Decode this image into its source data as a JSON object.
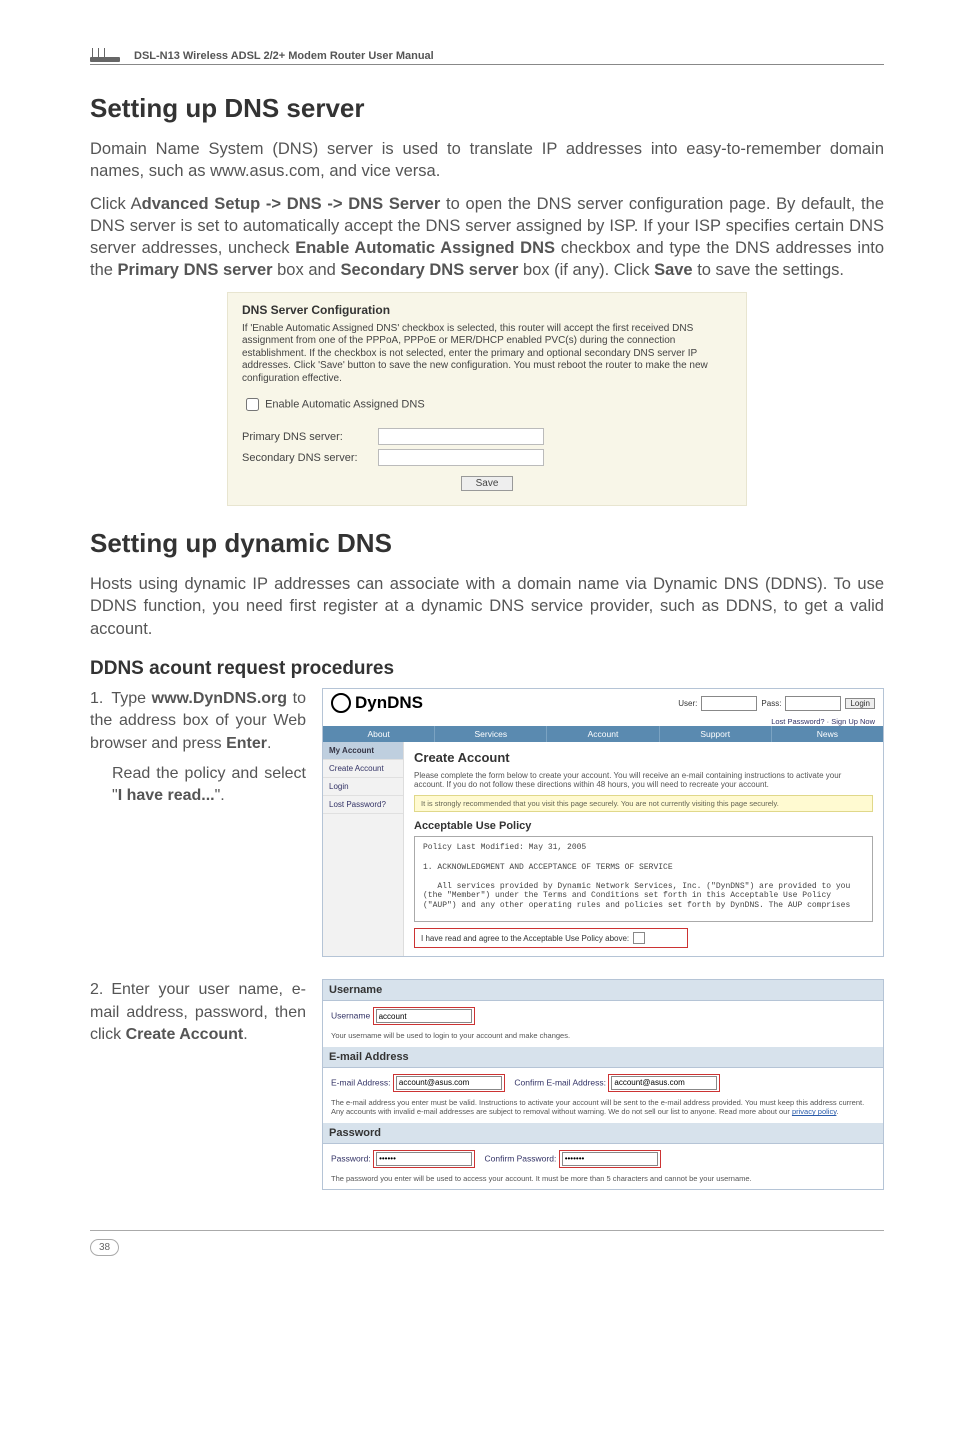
{
  "header": {
    "device_title": "DSL-N13 Wireless ADSL 2/2+ Modem Router User Manual"
  },
  "section1": {
    "title": "Setting up DNS server",
    "p1": "Domain Name System (DNS) server is used to translate IP addresses into easy-to-remember domain names, such as www.asus.com, and vice versa.",
    "p2_pre": "Click A",
    "p2_b1": "dvanced Setup -> DNS -> DNS Server",
    "p2_mid": " to open the DNS server configuration page. By default, the DNS server is set to automatically accept the DNS server assigned by ISP. If your ISP specifies certain DNS server addresses, uncheck ",
    "p2_b2": "Enable Automatic Assigned DNS",
    "p2_mid2": " checkbox and type the DNS addresses into the ",
    "p2_b3": "Primary DNS server",
    "p2_mid3": " box and ",
    "p2_b4": "Secondary DNS server",
    "p2_mid4": " box (if any). Click ",
    "p2_b5": "Save",
    "p2_end": " to save the settings."
  },
  "dnsbox": {
    "title": "DNS Server Configuration",
    "desc": "If 'Enable Automatic Assigned DNS' checkbox is selected, this router will accept the first received DNS assignment from one of the PPPoA, PPPoE or MER/DHCP enabled PVC(s) during the connection establishment. If the checkbox is not selected, enter the primary and optional secondary DNS server IP addresses. Click 'Save' button to save the new configuration. You must reboot the router to make the new configuration effective.",
    "chk": "Enable Automatic Assigned DNS",
    "primary": "Primary DNS server:",
    "secondary": "Secondary DNS server:",
    "save": "Save"
  },
  "section2": {
    "title": "Setting up dynamic DNS",
    "p1": "Hosts using dynamic IP addresses can associate with a domain name via Dynamic DNS (DDNS). To use DDNS function, you need first register at a dynamic DNS service provider, such as DDNS, to get a valid account."
  },
  "subheading": "DDNS acount request procedures",
  "step1": {
    "num": "1.",
    "line1_pre": "Type ",
    "line1_b": "www.DynDNS.org",
    "line1_post": " to the address box of your Web browser and press ",
    "line1_b2": "Enter",
    "line1_end": ".",
    "line2_pre": "Read the policy and select \"",
    "line2_b": "I have read...",
    "line2_end": "\"."
  },
  "dyndns": {
    "logo": "DynDNS",
    "user_lbl": "User:",
    "pass_lbl": "Pass:",
    "login_btn": "Login",
    "subsignup": "Lost Password? · Sign Up Now",
    "tabs": [
      "About",
      "Services",
      "Account",
      "Support",
      "News"
    ],
    "side_head": "My Account",
    "side_items": [
      "Create Account",
      "Login",
      "Lost Password?"
    ],
    "main_title": "Create Account",
    "main_note": "Please complete the form below to create your account. You will receive an e-mail containing instructions to activate your account. If you do not follow these directions within 48 hours, you will need to recreate your account.",
    "yellow": "It is strongly recommended that you visit this page securely. You are not currently visiting this page securely.",
    "aup_title": "Acceptable Use Policy",
    "aup_body": "Policy Last Modified: May 31, 2005\n\n1. ACKNOWLEDGMENT AND ACCEPTANCE OF TERMS OF SERVICE\n\n   All services provided by Dynamic Network Services, Inc. (\"DynDNS\") are provided to you (the \"Member\") under the Terms and Conditions set forth in this Acceptable Use Policy (\"AUP\") and any other operating rules and policies set forth by DynDNS. The AUP comprises",
    "aup_check": "I have read and agree to the Acceptable Use Policy above:"
  },
  "step2": {
    "num": "2.",
    "text_pre": "Enter your user name, e-mail address, password, then click ",
    "text_b": "Create Account",
    "text_end": "."
  },
  "form": {
    "username_h": "Username",
    "username_lbl": "Username",
    "username_val": "account",
    "username_note": "Your username will be used to login to your account and make changes.",
    "email_h": "E-mail Address",
    "email_lbl": "E-mail Address:",
    "email_val": "account@asus.com",
    "email_conf_lbl": "Confirm E-mail Address:",
    "email_conf_val": "account@asus.com",
    "email_note_1": "The e-mail address you enter must be valid. Instructions to activate your account will be sent to the e-mail address provided. You must keep this address current. Any accounts with invalid e-mail addresses are subject to removal without warning. We do not sell our list to anyone. Read more about our ",
    "email_note_link": "privacy policy",
    "email_note_2": ".",
    "password_h": "Password",
    "password_lbl": "Password:",
    "password_val": "••••••",
    "password_conf_lbl": "Confirm Password:",
    "password_conf_val": "•••••••",
    "password_note": "The password you enter will be used to access your account. It must be more than 5 characters and cannot be your username."
  },
  "footer": {
    "page": "38"
  }
}
